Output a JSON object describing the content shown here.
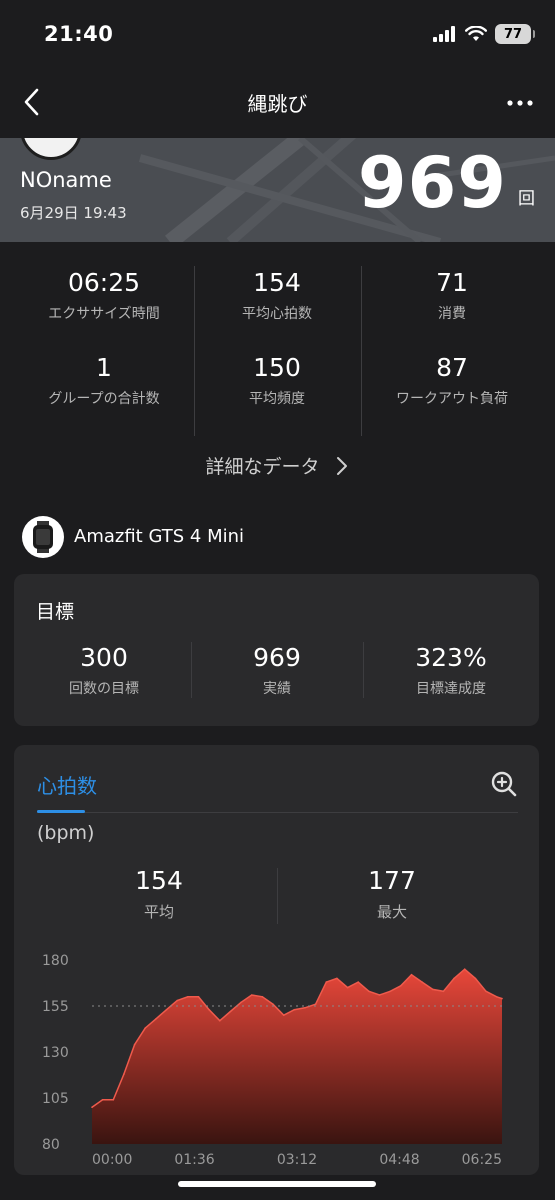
{
  "status_bar": {
    "time": "21:40",
    "battery": "77"
  },
  "nav": {
    "title": "縄跳び"
  },
  "hero": {
    "user": "NOname",
    "date": "6月29日 19:43",
    "count": "969",
    "unit": "回"
  },
  "stats": [
    {
      "value": "06:25",
      "label": "エクササイズ時間"
    },
    {
      "value": "154",
      "label": "平均心拍数"
    },
    {
      "value": "71",
      "label": "消費"
    },
    {
      "value": "1",
      "label": "グループの合計数"
    },
    {
      "value": "150",
      "label": "平均頻度"
    },
    {
      "value": "87",
      "label": "ワークアウト負荷"
    }
  ],
  "detail_link": "詳細なデータ",
  "device": {
    "name": "Amazfit GTS 4 Mini"
  },
  "goal": {
    "title": "目標",
    "items": [
      {
        "value": "300",
        "label": "回数の目標"
      },
      {
        "value": "969",
        "label": "実績"
      },
      {
        "value": "323%",
        "label": "目標達成度"
      }
    ]
  },
  "heart_rate": {
    "tab": "心拍数",
    "unit": "(bpm)",
    "avg": {
      "value": "154",
      "label": "平均"
    },
    "max": {
      "value": "177",
      "label": "最大"
    }
  },
  "colors": {
    "accent": "#2d8fe6",
    "chart_top": "#e8473a",
    "chart_bottom": "#3a1410"
  },
  "chart_data": {
    "type": "area",
    "xlabel": "",
    "ylabel": "",
    "x_ticks": [
      "00:00",
      "01:36",
      "03:12",
      "04:48",
      "06:25"
    ],
    "y_ticks": [
      180,
      155,
      130,
      105,
      80
    ],
    "ylim": [
      80,
      180
    ],
    "xlim_seconds": [
      0,
      385
    ],
    "reference_line": 155,
    "x_seconds": [
      0,
      10,
      20,
      30,
      40,
      50,
      60,
      70,
      80,
      90,
      100,
      110,
      120,
      130,
      140,
      150,
      160,
      170,
      180,
      190,
      200,
      210,
      220,
      230,
      240,
      250,
      260,
      270,
      280,
      290,
      300,
      310,
      320,
      330,
      340,
      350,
      360,
      370,
      380,
      385
    ],
    "bpm": [
      100,
      104,
      104,
      118,
      134,
      143,
      148,
      153,
      158,
      160,
      160,
      153,
      147,
      152,
      157,
      161,
      160,
      156,
      150,
      153,
      154,
      156,
      168,
      170,
      165,
      168,
      163,
      161,
      163,
      166,
      172,
      168,
      164,
      163,
      170,
      175,
      170,
      163,
      160,
      159
    ]
  }
}
